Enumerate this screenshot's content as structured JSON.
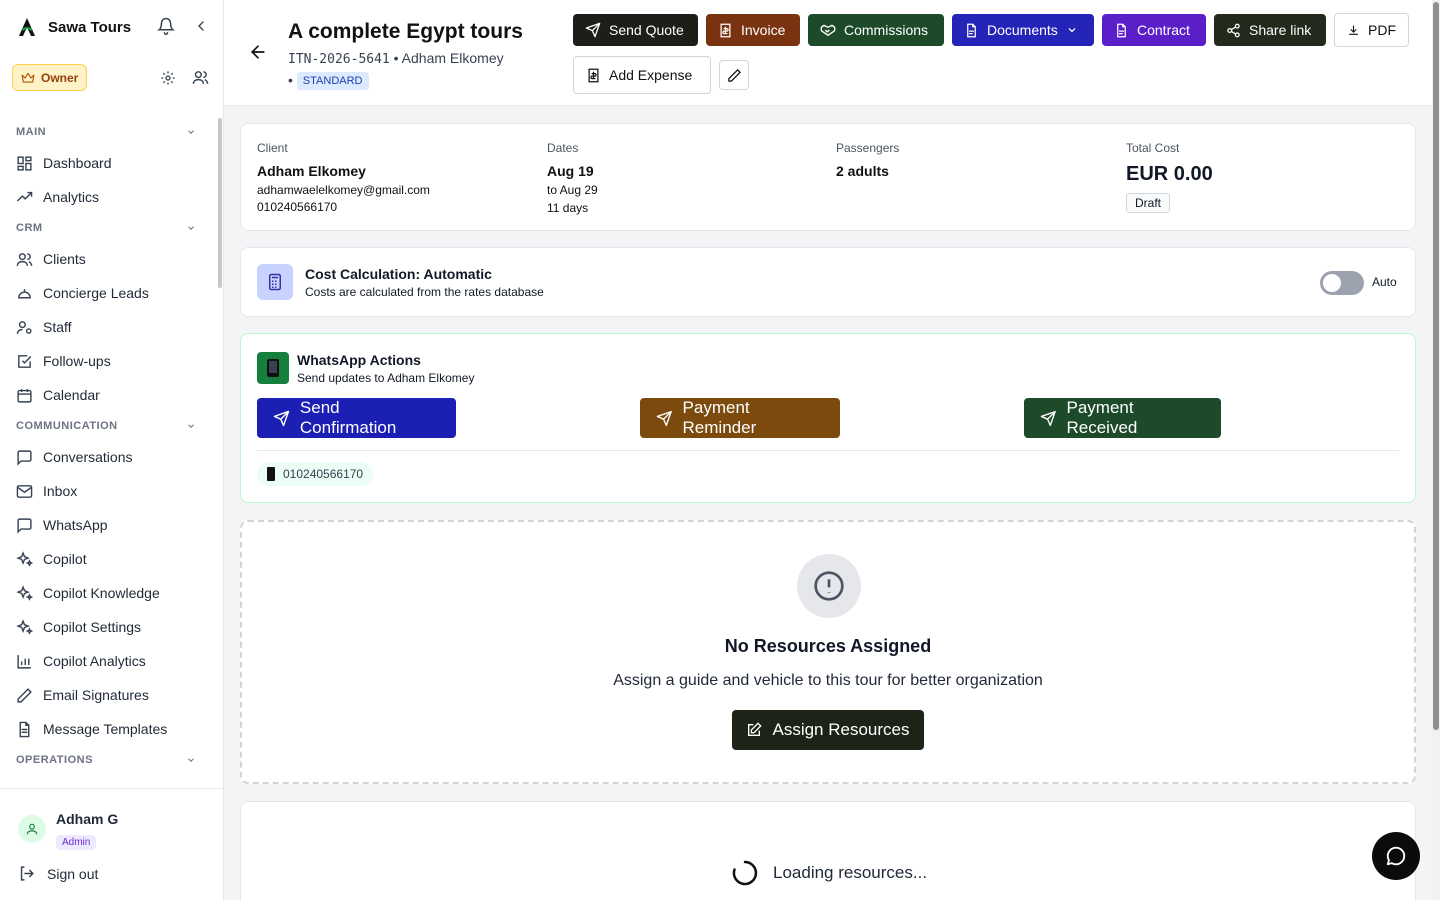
{
  "brand": {
    "name": "Sawa Tours"
  },
  "role": {
    "label": "Owner"
  },
  "nav": {
    "sections": [
      {
        "title": "MAIN",
        "items": [
          {
            "label": "Dashboard",
            "icon": "dashboard-icon"
          },
          {
            "label": "Analytics",
            "icon": "trending-up-icon"
          }
        ]
      },
      {
        "title": "CRM",
        "items": [
          {
            "label": "Clients",
            "icon": "users-icon"
          },
          {
            "label": "Concierge Leads",
            "icon": "concierge-bell-icon"
          },
          {
            "label": "Staff",
            "icon": "user-cog-icon"
          },
          {
            "label": "Follow-ups",
            "icon": "check-square-icon"
          },
          {
            "label": "Calendar",
            "icon": "calendar-icon"
          }
        ]
      },
      {
        "title": "COMMUNICATION",
        "items": [
          {
            "label": "Conversations",
            "icon": "message-square-icon"
          },
          {
            "label": "Inbox",
            "icon": "mail-icon"
          },
          {
            "label": "WhatsApp",
            "icon": "message-square-icon"
          },
          {
            "label": "Copilot",
            "icon": "sparkles-icon"
          },
          {
            "label": "Copilot Knowledge",
            "icon": "sparkles-icon"
          },
          {
            "label": "Copilot Settings",
            "icon": "sparkles-icon"
          },
          {
            "label": "Copilot Analytics",
            "icon": "bar-chart-icon"
          },
          {
            "label": "Email Signatures",
            "icon": "pen-icon"
          },
          {
            "label": "Message Templates",
            "icon": "file-text-icon"
          }
        ]
      },
      {
        "title": "OPERATIONS",
        "items": []
      }
    ]
  },
  "user": {
    "name": "Adham G",
    "role": "Admin",
    "signout": "Sign out"
  },
  "header": {
    "title": "A complete Egypt tours",
    "itinerary_id": "ITN-2026-5641",
    "client": "Adham Elkomey",
    "tier": "STANDARD",
    "buttons": {
      "send_quote": "Send Quote",
      "invoice": "Invoice",
      "commissions": "Commissions",
      "documents": "Documents",
      "contract": "Contract",
      "share_link": "Share link",
      "pdf": "PDF",
      "add_expense": "Add Expense"
    }
  },
  "summary": {
    "client_label": "Client",
    "client_name": "Adham Elkomey",
    "client_email": "adhamwaelelkomey@gmail.com",
    "client_phone": "010240566170",
    "dates_label": "Dates",
    "start": "Aug 19",
    "end": "to Aug 29",
    "duration": "11 days",
    "passengers_label": "Passengers",
    "passengers": "2 adults",
    "total_label": "Total Cost",
    "total": "EUR 0.00",
    "status": "Draft"
  },
  "cost_calc": {
    "title": "Cost Calculation: Automatic",
    "subtitle": "Costs are calculated from the rates database",
    "toggle_label": "Auto"
  },
  "whatsapp": {
    "title": "WhatsApp Actions",
    "subtitle": "Send updates to Adham Elkomey",
    "confirm": "Send Confirmation",
    "reminder": "Payment Reminder",
    "received": "Payment Received",
    "phone": "010240566170"
  },
  "resources": {
    "title": "No Resources Assigned",
    "subtitle": "Assign a guide and vehicle to this tour for better organization",
    "button": "Assign Resources",
    "loading": "Loading resources..."
  },
  "colors": {
    "send_quote": "#1c1f17",
    "invoice": "#7a3311",
    "commissions": "#1d4b2a",
    "documents": "#2424b8",
    "contract": "#5b1fc9",
    "share_link": "#222a1c",
    "confirm": "#1c1fb3",
    "reminder": "#7b4a0c",
    "received": "#1d4b2a",
    "assign": "#1c2418"
  }
}
